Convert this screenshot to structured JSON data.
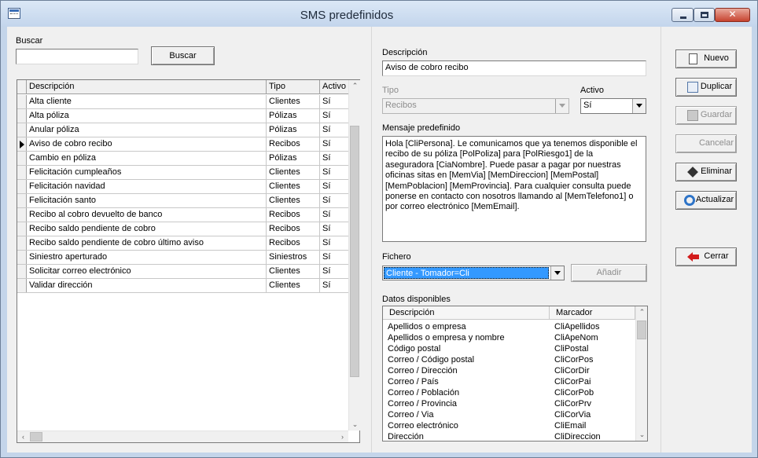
{
  "window": {
    "title": "SMS predefinidos"
  },
  "search": {
    "label": "Buscar",
    "value": "",
    "button_label": "Buscar"
  },
  "grid": {
    "columns": [
      "Descripción",
      "Tipo",
      "Activo"
    ],
    "rows": [
      {
        "desc": "Alta cliente",
        "tipo": "Clientes",
        "activo": "Sí"
      },
      {
        "desc": "Alta póliza",
        "tipo": "Pólizas",
        "activo": "Sí"
      },
      {
        "desc": "Anular póliza",
        "tipo": "Pólizas",
        "activo": "Sí"
      },
      {
        "desc": "Aviso de cobro recibo",
        "tipo": "Recibos",
        "activo": "Sí",
        "current": true
      },
      {
        "desc": "Cambio en póliza",
        "tipo": "Pólizas",
        "activo": "Sí"
      },
      {
        "desc": "Felicitación cumpleaños",
        "tipo": "Clientes",
        "activo": "Sí"
      },
      {
        "desc": "Felicitación navidad",
        "tipo": "Clientes",
        "activo": "Sí"
      },
      {
        "desc": "Felicitación santo",
        "tipo": "Clientes",
        "activo": "Sí"
      },
      {
        "desc": "Recibo al cobro devuelto de banco",
        "tipo": "Recibos",
        "activo": "Sí"
      },
      {
        "desc": "Recibo saldo pendiente de cobro",
        "tipo": "Recibos",
        "activo": "Sí"
      },
      {
        "desc": "Recibo saldo pendiente de cobro último aviso",
        "tipo": "Recibos",
        "activo": "Sí"
      },
      {
        "desc": "Siniestro aperturado",
        "tipo": "Siniestros",
        "activo": "Sí"
      },
      {
        "desc": "Solicitar correo electrónico",
        "tipo": "Clientes",
        "activo": "Sí"
      },
      {
        "desc": "Validar dirección",
        "tipo": "Clientes",
        "activo": "Sí"
      }
    ]
  },
  "detail": {
    "descripcion_label": "Descripción",
    "descripcion_value": "Aviso de cobro recibo",
    "tipo_label": "Tipo",
    "tipo_value": "Recibos",
    "activo_label": "Activo",
    "activo_value": "Sí",
    "mensaje_label": "Mensaje predefinido",
    "mensaje_value": "Hola [CliPersona]. Le comunicamos que ya tenemos disponible el recibo de su póliza [PolPoliza] para [PolRiesgo1] de la aseguradora [CiaNombre]. Puede pasar a pagar por nuestras oficinas sitas en [MemVia] [MemDireccion] [MemPostal] [MemPoblacion] [MemProvincia]. Para cualquier consulta puede ponerse en contacto con nosotros llamando al [MemTelefono1] o por correo electrónico [MemEmail].",
    "fichero_label": "Fichero",
    "fichero_value": "Cliente - Tomador=Cli",
    "anadir_label": "Añadir",
    "datos_label": "Datos disponibles",
    "datos_columns": [
      "Descripción",
      "Marcador"
    ],
    "datos_rows": [
      {
        "desc": "Apellidos o empresa",
        "marcador": "CliApellidos"
      },
      {
        "desc": "Apellidos o empresa y nombre",
        "marcador": "CliApeNom"
      },
      {
        "desc": "Código postal",
        "marcador": "CliPostal"
      },
      {
        "desc": "Correo / Código postal",
        "marcador": "CliCorPos"
      },
      {
        "desc": "Correo / Dirección",
        "marcador": "CliCorDir"
      },
      {
        "desc": "Correo / País",
        "marcador": "CliCorPai"
      },
      {
        "desc": "Correo / Población",
        "marcador": "CliCorPob"
      },
      {
        "desc": "Correo / Provincia",
        "marcador": "CliCorPrv"
      },
      {
        "desc": "Correo / Via",
        "marcador": "CliCorVia"
      },
      {
        "desc": "Correo electrónico",
        "marcador": "CliEmail"
      },
      {
        "desc": "Dirección",
        "marcador": "CliDireccion"
      }
    ]
  },
  "actions": {
    "nuevo": "Nuevo",
    "duplicar": "Duplicar",
    "guardar": "Guardar",
    "cancelar": "Cancelar",
    "eliminar": "Eliminar",
    "actualizar": "Actualizar",
    "cerrar": "Cerrar"
  }
}
